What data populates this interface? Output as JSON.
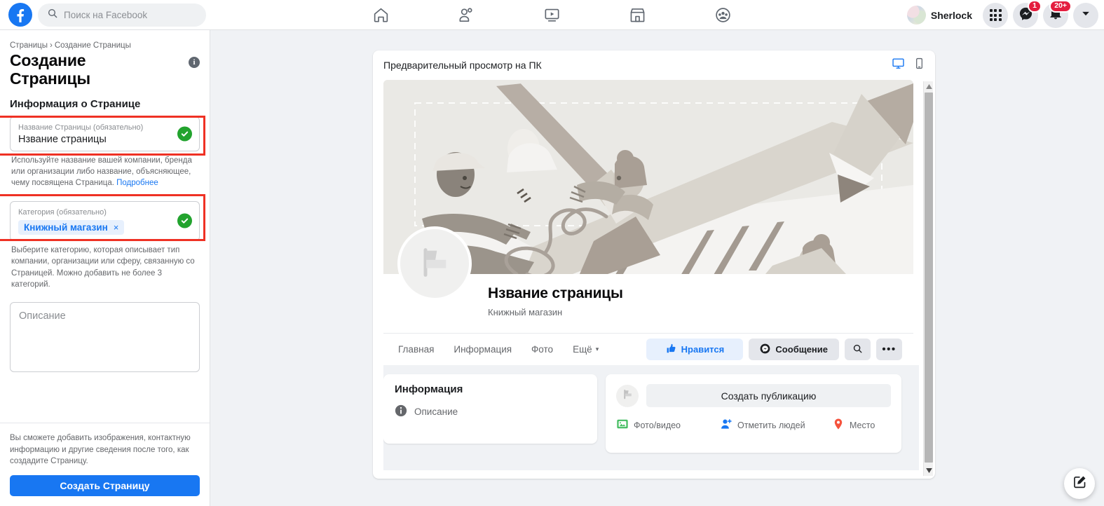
{
  "topbar": {
    "logo_icon": "facebook-logo-icon",
    "search": {
      "icon": "search-icon",
      "placeholder": "Поиск на Facebook",
      "value": ""
    },
    "nav": [
      {
        "name": "home",
        "icon": "home-icon"
      },
      {
        "name": "friends",
        "icon": "friends-icon"
      },
      {
        "name": "watch",
        "icon": "video-play-icon"
      },
      {
        "name": "marketplace",
        "icon": "storefront-icon"
      },
      {
        "name": "groups",
        "icon": "groups-icon"
      }
    ],
    "account": {
      "name": "Sherlock",
      "avatar_icon": "user-avatar"
    },
    "menu_icon": "grid-apps-icon",
    "messenger": {
      "icon": "messenger-icon",
      "badge": "1"
    },
    "notifications": {
      "icon": "bell-icon",
      "badge": "20+"
    },
    "account_menu_icon": "chevron-down-icon"
  },
  "sidebar": {
    "breadcrumb": {
      "root": "Страницы",
      "separator": "›",
      "current": "Создание Страницы"
    },
    "title": "Создание Страницы",
    "info_icon": "info-icon",
    "section_heading": "Информация о Странице",
    "name_field": {
      "label": "Название Страницы (обязательно)",
      "value": "Нзвание страницы",
      "valid_icon": "check-circle-icon",
      "helper": "Используйте название вашей компании, бренда или организации либо название, объясняющее, чему посвящена Страница.",
      "helper_link": "Подробнее"
    },
    "category_field": {
      "label": "Категория (обязательно)",
      "chip": "Книжный магазин",
      "chip_remove_icon": "×",
      "valid_icon": "check-circle-icon",
      "helper": "Выберите категорию, которая описывает тип компании, организации или сферу, связанную со Страницей. Можно добавить не более 3 категорий."
    },
    "description_field": {
      "placeholder": "Описание",
      "value": ""
    },
    "footer_note": "Вы сможете добавить изображения, контактную информацию и другие сведения после того, как создадите Страницу.",
    "submit_label": "Создать Страницу"
  },
  "preview": {
    "title": "Предварительный просмотр на ПК",
    "device_desktop_icon": "desktop-icon",
    "device_mobile_icon": "mobile-icon",
    "cover_icon": "cover-illustration",
    "page_avatar_icon": "flag-icon",
    "page_name": "Нзвание страницы",
    "page_category": "Книжный магазин",
    "tabs": [
      {
        "label": "Главная"
      },
      {
        "label": "Информация"
      },
      {
        "label": "Фото"
      },
      {
        "label": "Ещё",
        "caret": "▾"
      }
    ],
    "actions": {
      "like": {
        "label": "Нравится",
        "icon": "thumbs-up-icon"
      },
      "message": {
        "label": "Сообщение",
        "icon": "messenger-icon"
      },
      "search_icon": "search-icon",
      "more_icon": "ellipsis-icon"
    },
    "info_card": {
      "heading": "Информация",
      "row_icon": "info-icon",
      "row_label": "Описание"
    },
    "post_card": {
      "avatar_icon": "flag-icon",
      "composer_placeholder": "Создать публикацию",
      "actions": [
        {
          "label": "Фото/видео",
          "icon": "photo-video-icon",
          "color": "#45bd62"
        },
        {
          "label": "Отметить людей",
          "icon": "tag-people-icon",
          "color": "#1877f2"
        },
        {
          "label": "Место",
          "icon": "location-pin-icon",
          "color": "#f5533d"
        }
      ]
    },
    "scrollbar": {
      "up_icon": "caret-up-icon",
      "down_icon": "caret-down-icon"
    }
  },
  "fab": {
    "icon": "compose-edit-icon"
  },
  "colors": {
    "brand_blue": "#1877f2",
    "page_bg": "#f0f2f5",
    "annotation_red": "#ef3124",
    "valid_green": "#22a32e",
    "badge_red": "#e41e3f"
  },
  "annotations": [
    {
      "name": "highlight-name-field"
    },
    {
      "name": "highlight-category-field"
    }
  ]
}
